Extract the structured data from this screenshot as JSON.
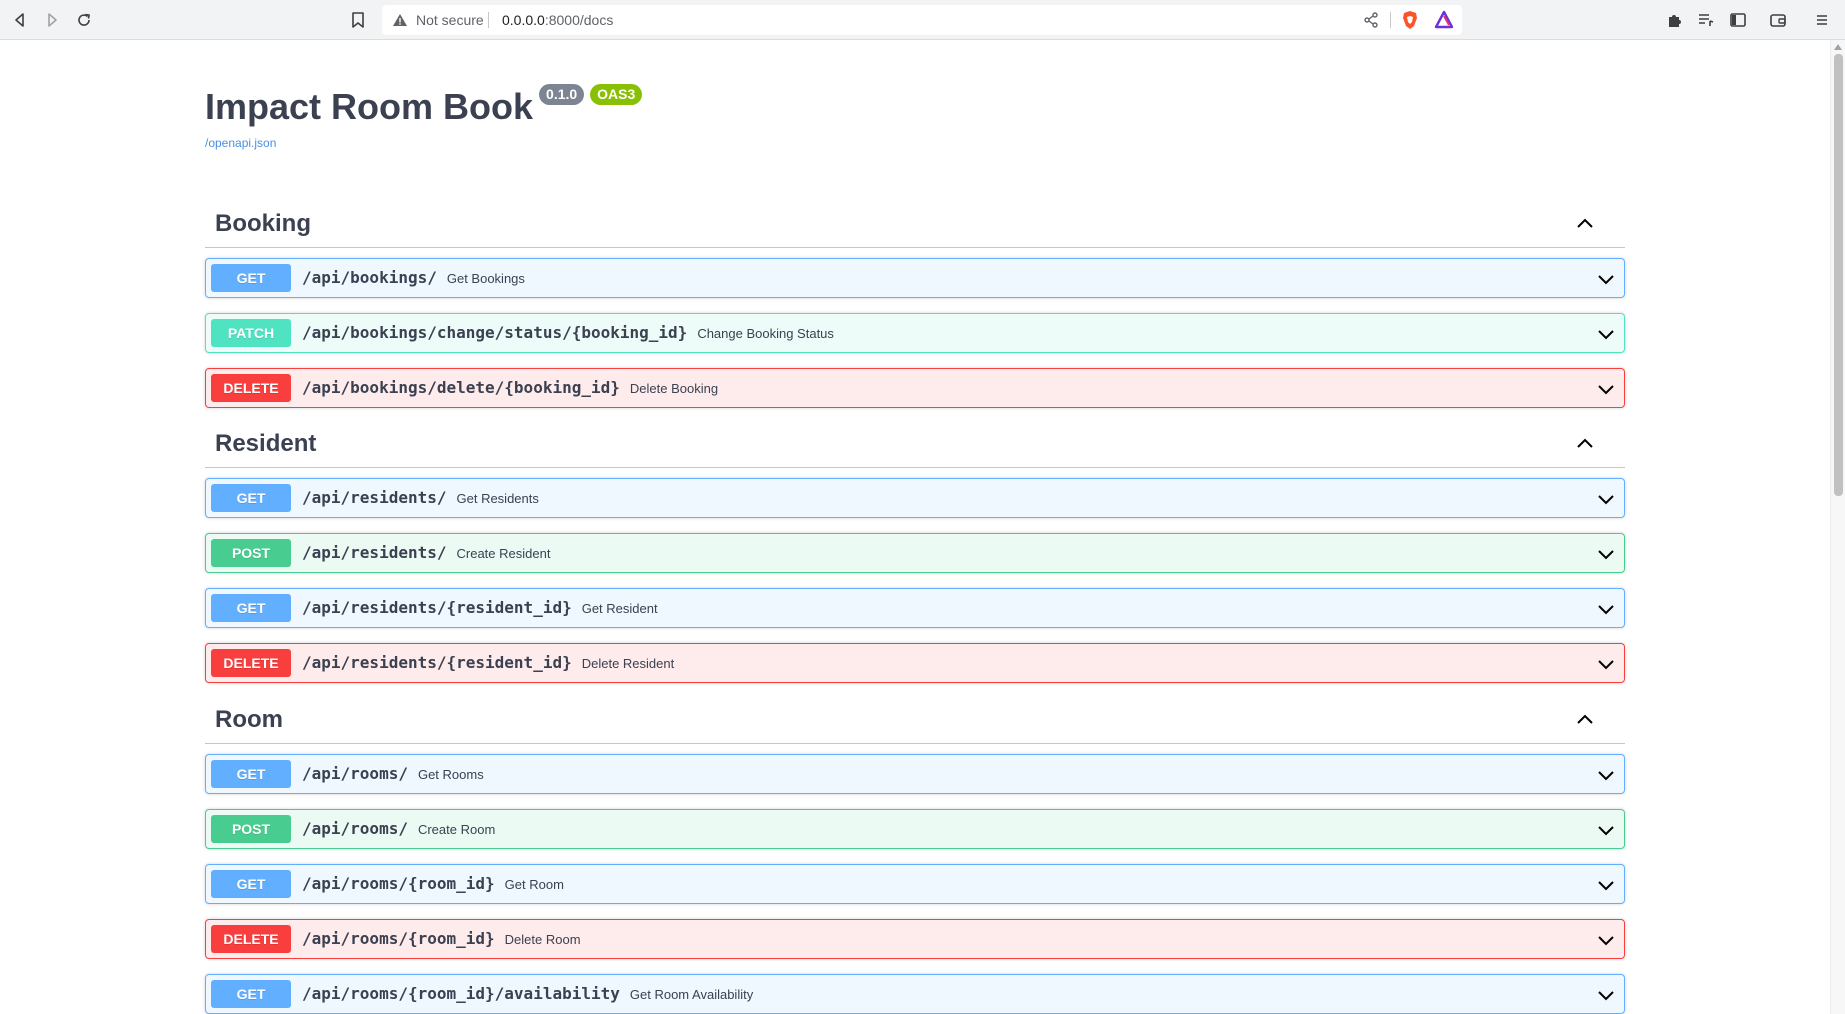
{
  "browser": {
    "security_label": "Not secure",
    "url_host": "0.0.0.0",
    "url_rest": ":8000/docs"
  },
  "api": {
    "title": "Impact Room Book",
    "version": "0.1.0",
    "oas": "OAS3",
    "spec_link": "/openapi.json"
  },
  "colors": {
    "get": "#61affe",
    "post": "#49cc90",
    "patch": "#50e3c2",
    "delete": "#f93e3e"
  },
  "sections": [
    {
      "name": "Booking",
      "operations": [
        {
          "method": "GET",
          "path": "/api/bookings/",
          "summary": "Get Bookings"
        },
        {
          "method": "PATCH",
          "path": "/api/bookings/change/status/{booking_id}",
          "summary": "Change Booking Status"
        },
        {
          "method": "DELETE",
          "path": "/api/bookings/delete/{booking_id}",
          "summary": "Delete Booking"
        }
      ]
    },
    {
      "name": "Resident",
      "operations": [
        {
          "method": "GET",
          "path": "/api/residents/",
          "summary": "Get Residents"
        },
        {
          "method": "POST",
          "path": "/api/residents/",
          "summary": "Create Resident"
        },
        {
          "method": "GET",
          "path": "/api/residents/{resident_id}",
          "summary": "Get Resident"
        },
        {
          "method": "DELETE",
          "path": "/api/residents/{resident_id}",
          "summary": "Delete Resident"
        }
      ]
    },
    {
      "name": "Room",
      "operations": [
        {
          "method": "GET",
          "path": "/api/rooms/",
          "summary": "Get Rooms"
        },
        {
          "method": "POST",
          "path": "/api/rooms/",
          "summary": "Create Room"
        },
        {
          "method": "GET",
          "path": "/api/rooms/{room_id}",
          "summary": "Get Room"
        },
        {
          "method": "DELETE",
          "path": "/api/rooms/{room_id}",
          "summary": "Delete Room"
        },
        {
          "method": "GET",
          "path": "/api/rooms/{room_id}/availability",
          "summary": "Get Room Availability"
        }
      ]
    }
  ]
}
